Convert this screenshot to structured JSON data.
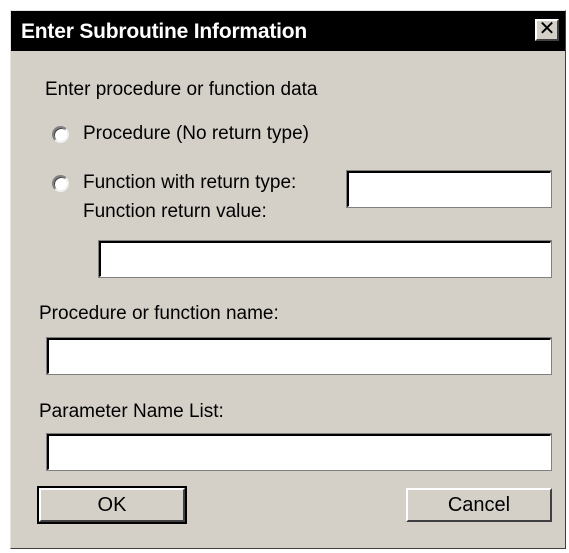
{
  "window": {
    "title": "Enter Subroutine Information",
    "close_glyph": "✕"
  },
  "form": {
    "heading": "Enter procedure or function data",
    "radio_procedure_label": "Procedure (No return type)",
    "radio_function_label": "Function with return type:",
    "function_return_type_value": "",
    "function_return_value_label": "Function return value:",
    "function_return_value_value": "",
    "name_label": "Procedure or function name:",
    "name_value": "",
    "params_label": "Parameter Name List:",
    "params_value": ""
  },
  "buttons": {
    "ok_label": "OK",
    "cancel_label": "Cancel"
  },
  "colors": {
    "dialog_face": "#d4d0c8",
    "titlebar": "#000000",
    "title_text": "#ffffff"
  }
}
